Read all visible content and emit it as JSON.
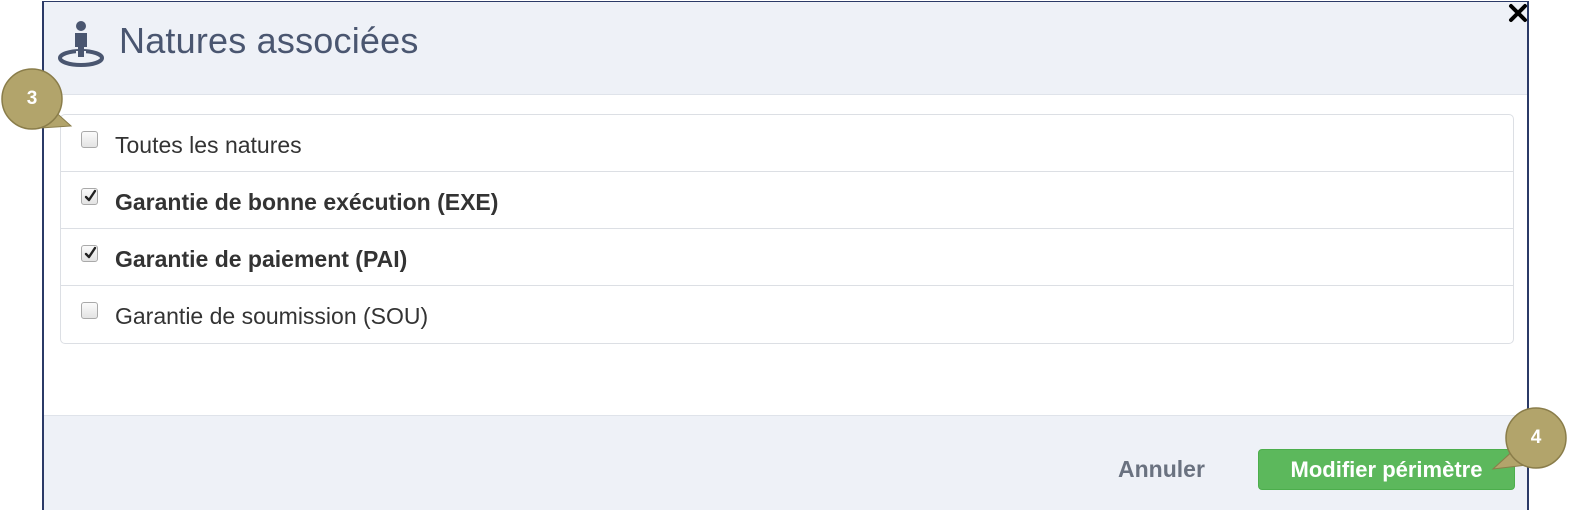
{
  "dialog": {
    "title": "Natures associées",
    "close_icon": "close-icon",
    "header_icon": "person-location-icon"
  },
  "natures": [
    {
      "label": "Toutes les natures",
      "checked": false
    },
    {
      "label": "Garantie de bonne exécution (EXE)",
      "checked": true
    },
    {
      "label": "Garantie de paiement (PAI)",
      "checked": true
    },
    {
      "label": "Garantie de soumission (SOU)",
      "checked": false
    }
  ],
  "footer": {
    "cancel_label": "Annuler",
    "submit_label": "Modifier périmètre"
  },
  "annotations": [
    {
      "number": "3"
    },
    {
      "number": "4"
    }
  ],
  "colors": {
    "header_bg": "#eef1f7",
    "title": "#4a5670",
    "submit_bg": "#5cb85c",
    "callout_bg": "#b2a46b",
    "border": "#2b3a67"
  }
}
